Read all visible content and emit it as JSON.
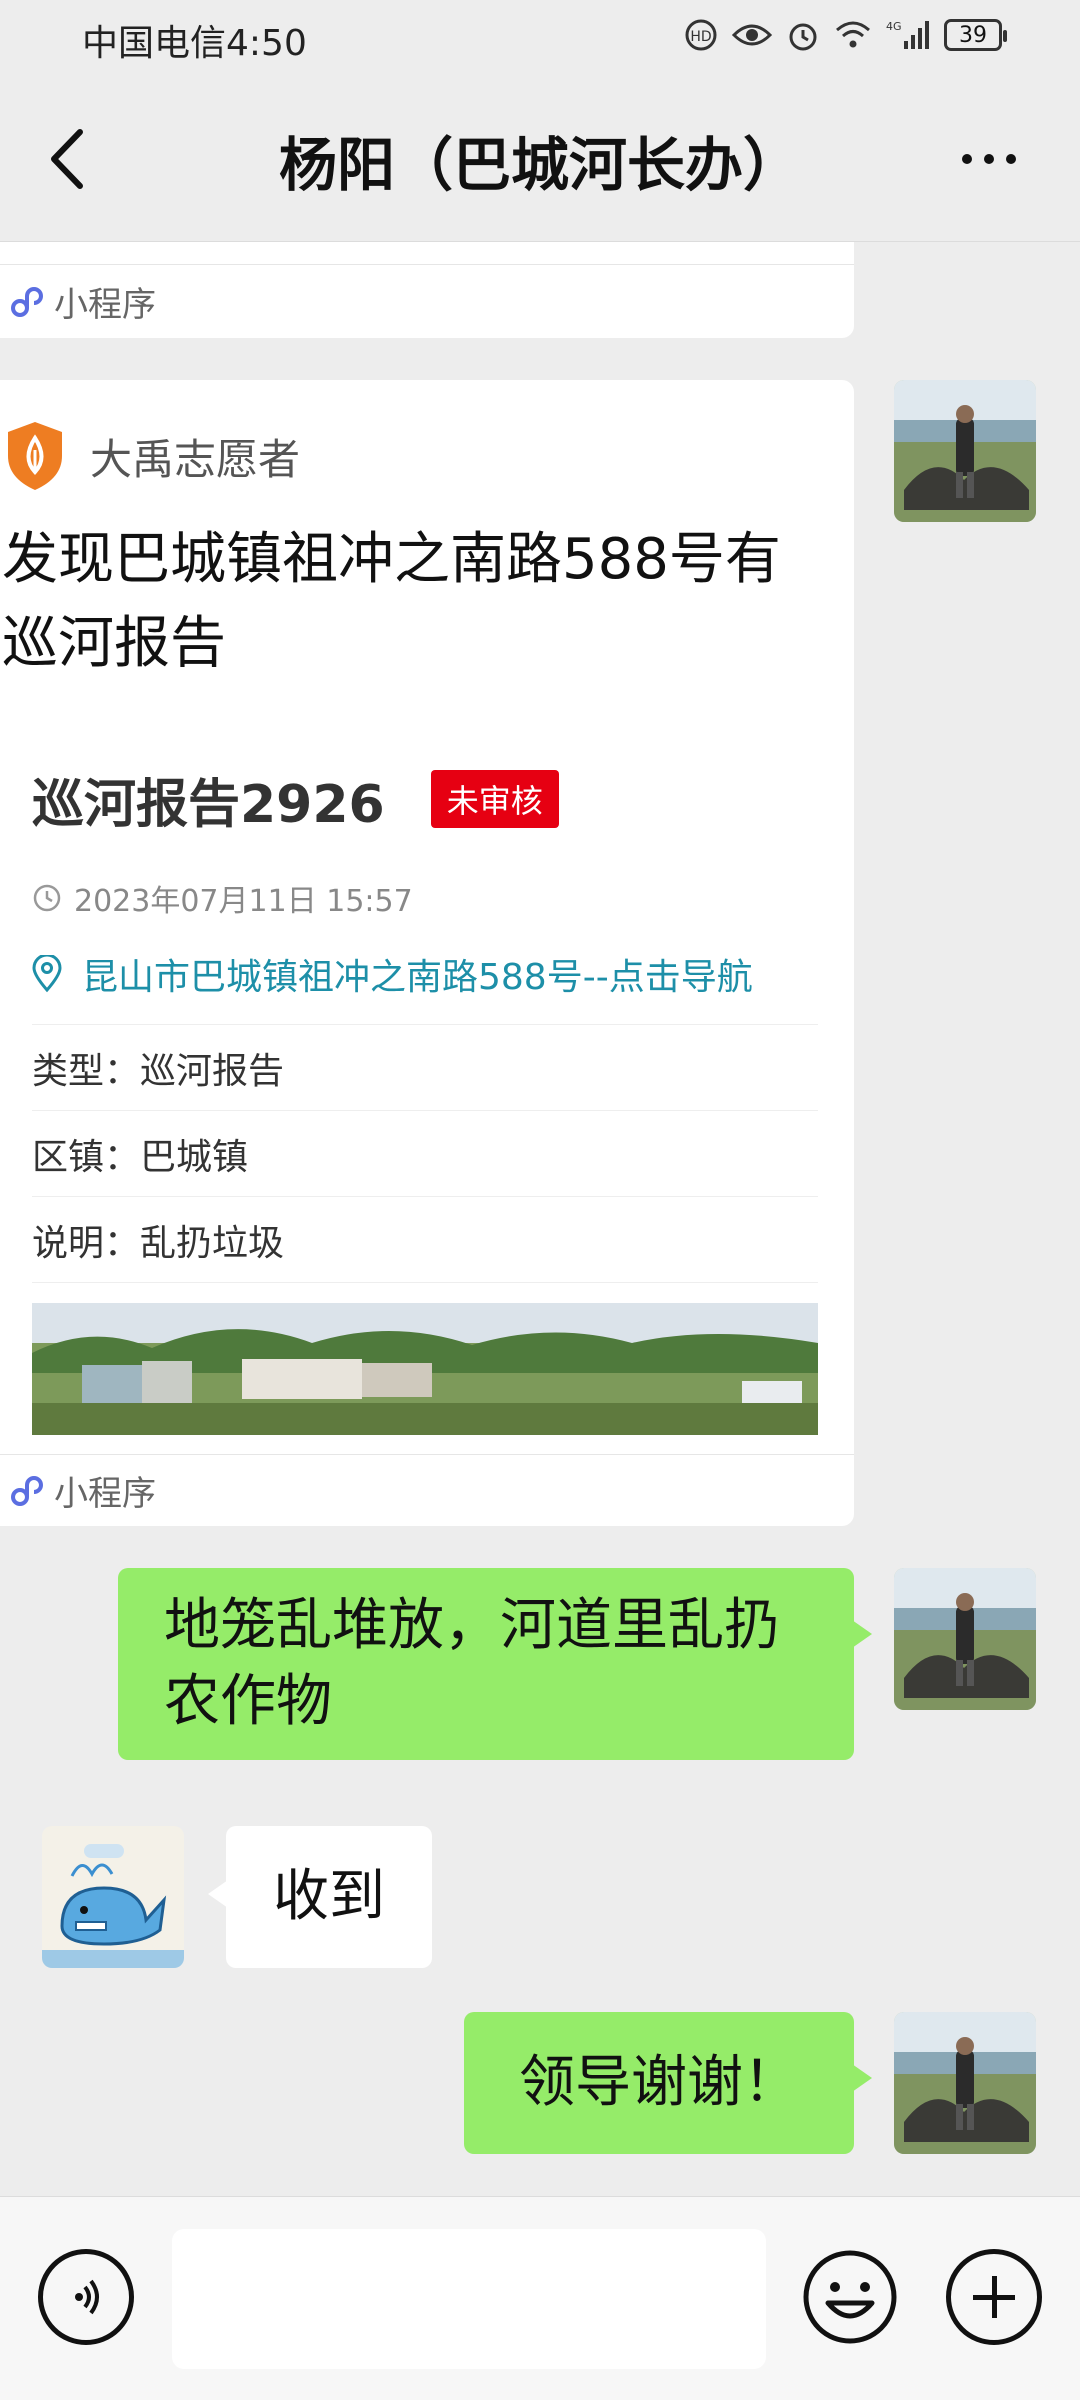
{
  "status_bar": {
    "carrier_time": "中国电信4:50",
    "network": "4G",
    "battery": "39"
  },
  "header": {
    "title": "杨阳（巴城河长办）"
  },
  "messages": {
    "mini_program_label_1": "小程序",
    "card": {
      "source": "大禹志愿者",
      "description": "发现巴城镇祖冲之南路588号有巡河报告",
      "report_title": "巡河报告2926",
      "badge": "未审核",
      "time": "2023年07月11日 15:57",
      "location": "昆山市巴城镇祖冲之南路588号--点击导航",
      "rows": [
        "类型：巡河报告",
        "区镇：巴城镇",
        "说明：乱扔垃圾"
      ],
      "footer": "小程序"
    },
    "sent_1": "地笼乱堆放，河道里乱扔农作物",
    "received_1": "收到",
    "sent_2": "领导谢谢！"
  },
  "input": {
    "placeholder": ""
  },
  "colors": {
    "green_bubble": "#95ec69",
    "badge_red": "#e60012",
    "link_teal": "#1d8fa8",
    "background": "#ededed"
  },
  "icons": [
    "back-arrow-icon",
    "more-icon",
    "mini-program-icon",
    "shield-leaf-icon",
    "clock-icon",
    "location-pin-icon",
    "voice-icon",
    "emoji-icon",
    "plus-icon"
  ]
}
